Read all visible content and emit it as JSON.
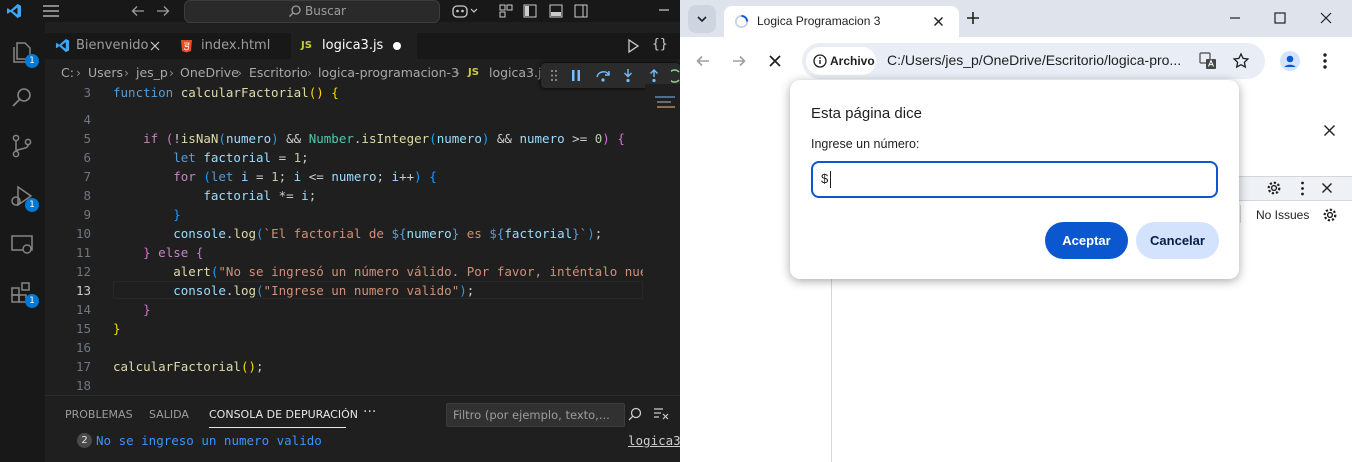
{
  "vscode": {
    "search_placeholder": "Buscar",
    "tabs": [
      {
        "label": "Bienvenido"
      },
      {
        "label": "index.html"
      },
      {
        "label": "logica3.js",
        "icon_text": "JS"
      }
    ],
    "breadcrumb": [
      "C:",
      "Users",
      "jes_p",
      "OneDrive",
      "Escritorio",
      "logica-programacion-3",
      "logica3.js"
    ],
    "breadcrumb_js": "JS",
    "badges": {
      "explorer": "1",
      "debug": "1",
      "extensions": "1"
    },
    "line_numbers": [
      "3",
      "4",
      "5",
      "6",
      "7",
      "8",
      "9",
      "10",
      "11",
      "12",
      "13",
      "14",
      "15",
      "16",
      "17",
      "18"
    ],
    "panel": {
      "tabs": [
        "PROBLEMAS",
        "SALIDA",
        "CONSOLA DE DEPURACIÓN"
      ],
      "more": "···",
      "filter_placeholder": "Filtro (por ejemplo, texto,...",
      "output_count": "2",
      "output_text": "No se ingreso un numero valido",
      "output_source": "logica3"
    }
  },
  "chrome": {
    "tab_title": "Logica Programacion 3",
    "site_chip": "Archivo",
    "url": "C:/Users/jes_p/OneDrive/Escritorio/logica-pro...",
    "devtools_issues": "No Issues",
    "dialog": {
      "title": "Esta página dice",
      "prompt": "Ingrese un número:",
      "input_value": "$",
      "ok_label": "Aceptar",
      "cancel_label": "Cancelar"
    }
  },
  "colors": {
    "accent": "#0b57d0",
    "vscode_bg": "#1f1f1f",
    "vscode_badge": "#0078d4"
  }
}
